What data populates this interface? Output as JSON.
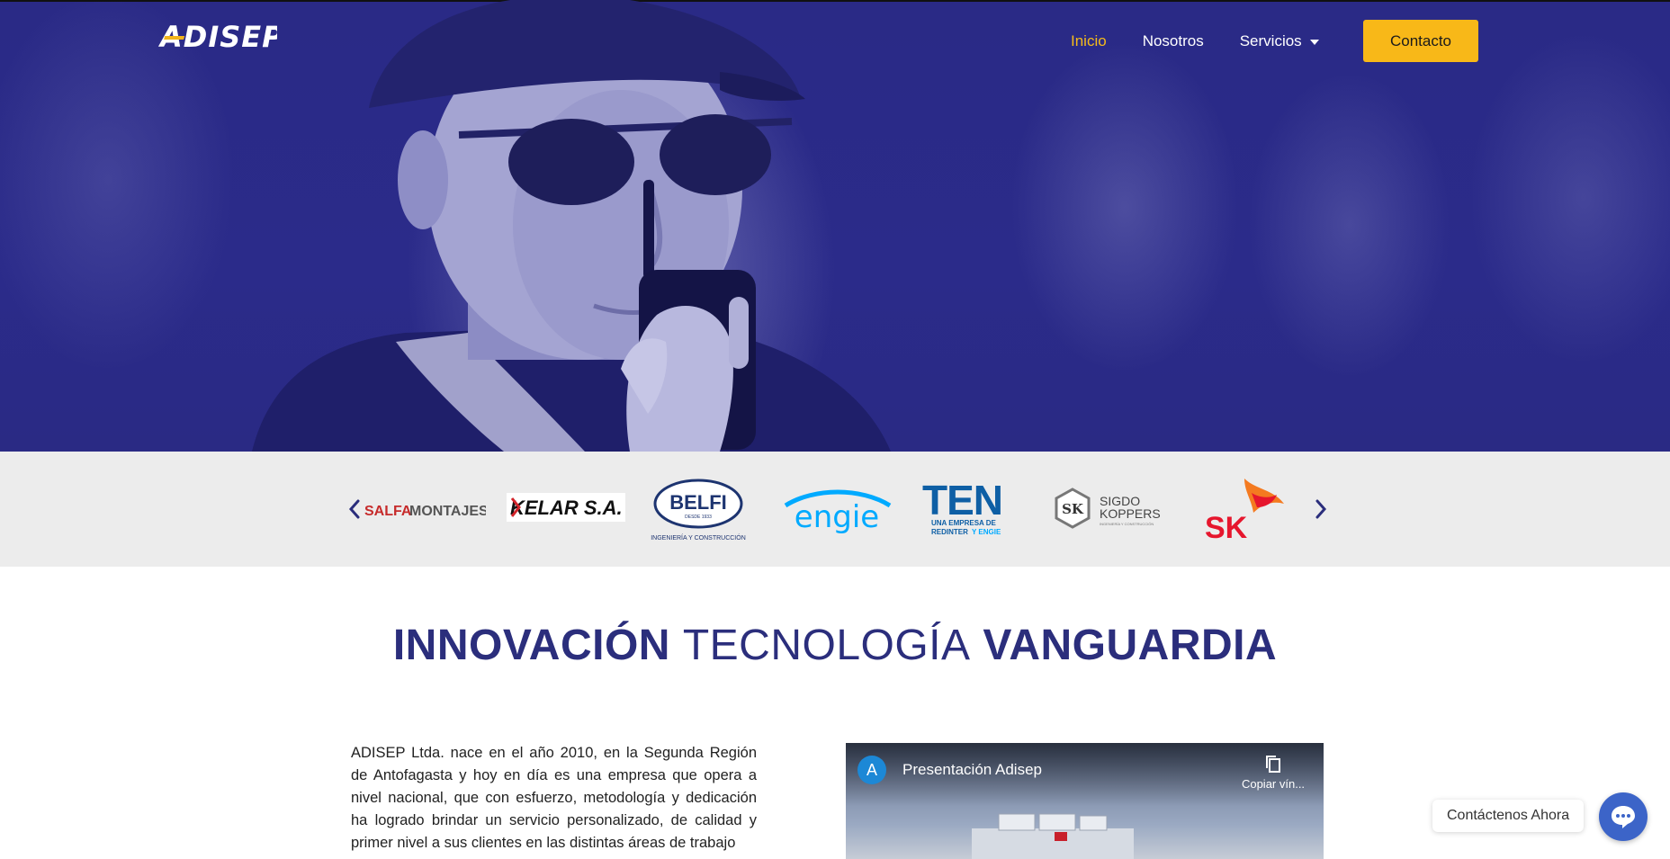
{
  "brand": {
    "logo_main": "ADISEP",
    "accent_color": "#f8b818",
    "primary_color": "#2b2e7c"
  },
  "nav": {
    "items": [
      {
        "label": "Inicio",
        "active": true
      },
      {
        "label": "Nosotros",
        "active": false
      },
      {
        "label": "Servicios",
        "active": false,
        "has_dropdown": true
      }
    ],
    "contact_label": "Contacto"
  },
  "clients": {
    "logos": [
      {
        "name": "salfamontajes-logo",
        "text_a": "SALFA",
        "text_b": "MONTAJES"
      },
      {
        "name": "kelar-logo",
        "text": "KELAR S.A."
      },
      {
        "name": "belfi-logo",
        "text": "BELFI",
        "sub": "DESDE 1933",
        "caption": "INGENIERÍA Y CONSTRUCCIÓN"
      },
      {
        "name": "engie-logo",
        "text": "engie"
      },
      {
        "name": "ten-logo",
        "text": "TEN",
        "caption_1": "UNA EMPRESA DE",
        "caption_2": "REDINTER",
        "caption_3": "Y ENGIE"
      },
      {
        "name": "sigdo-koppers-logo",
        "badge": "SK",
        "line1": "SIGDO",
        "line2": "KOPPERS",
        "caption": "INGENIERÍA Y CONSTRUCCIÓN"
      },
      {
        "name": "sk-logo",
        "text": "SK"
      }
    ]
  },
  "headline": {
    "part1": "INNOVACIÓN",
    "part2": "TECNOLOGÍA",
    "part3": "VANGUARDIA"
  },
  "intro": {
    "text": "ADISEP Ltda. nace en el año 2010, en la Segunda Región de Antofagasta y hoy en día es una empresa que opera a nivel nacional, que con esfuerzo, metodología y dedicación ha logrado brindar un servicio personalizado, de calidad y primer nivel a sus clientes en las distintas áreas de trabajo"
  },
  "video": {
    "channel_initial": "A",
    "title": "Presentación Adisep",
    "copy_label": "Copiar vín..."
  },
  "chat": {
    "label": "Contáctenos Ahora"
  }
}
